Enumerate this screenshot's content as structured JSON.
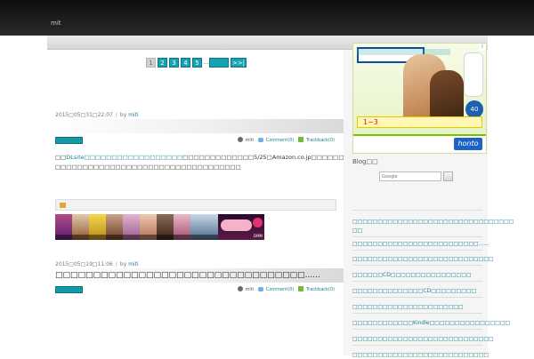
{
  "site": {
    "title": "",
    "description": "mit"
  },
  "nav": {
    "items": [
      {
        "label": ""
      },
      {
        "label": ""
      }
    ]
  },
  "pagination": {
    "pages": [
      "1",
      "2",
      "3",
      "4",
      "5"
    ],
    "current": "1",
    "ellipsis": "…",
    "last": ">>|"
  },
  "posts": [
    {
      "date": "2015",
      "day": "31",
      "time": "22:07",
      "by": "by",
      "author": "miti",
      "title": "",
      "info": {
        "author": "miti",
        "comment": "Comment(0)",
        "trackback": "Trackback(0)"
      },
      "body_link": "DLsite",
      "body_text": "5/25",
      "body_text2": "Amazon.co.jp",
      "more": "",
      "tag": "",
      "banner": {
        "tagline": "",
        "brand": "DMM"
      }
    },
    {
      "date": "2015",
      "day": "19",
      "time": "11:06",
      "by": "by",
      "author": "miti",
      "title": "......",
      "info": {
        "author": "miti",
        "comment": "Comment(0)",
        "trackback": "Trackback(0)"
      },
      "body_text": "",
      "body_link": ""
    }
  ],
  "sidebar": {
    "ad": {
      "title": "",
      "strip": "1~3",
      "bottom_text": "",
      "brand": "honto",
      "badge": "40"
    },
    "blog_title": "Blog",
    "search_placeholder": "Google",
    "recent_title": "",
    "recent_items": [
      {
        "label": ""
      },
      {
        "label": "……"
      },
      {
        "label": ""
      },
      {
        "label": "CD"
      },
      {
        "label": "CD"
      },
      {
        "label": ""
      },
      {
        "label": "Kindle"
      },
      {
        "label": ""
      }
    ]
  },
  "colors": {
    "accent": "#17a2b3",
    "link": "#1a7f8e",
    "header_bg": "#1c1c1c",
    "sidebar_bg": "#f5f5f5"
  },
  "icons": [
    "user-icon",
    "comment-icon",
    "trackback-icon",
    "tag-icon",
    "search-icon"
  ]
}
